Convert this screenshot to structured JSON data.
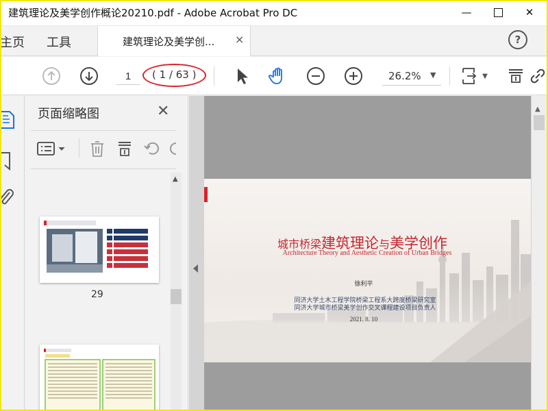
{
  "window": {
    "title": "建筑理论及美学创作概论20210.pdf - Adobe Acrobat Pro DC",
    "minimize": "—",
    "close": "✕"
  },
  "tabs": {
    "home": "主页",
    "tools": "工具",
    "doc_tab": "建筑理论及美学创...",
    "doc_tab_close": "×",
    "help": "?"
  },
  "toolbar": {
    "page_current": "1",
    "page_total": "( 1 / 63 )",
    "zoom": "26.2%",
    "icons": [
      "prev-page-icon",
      "next-page-icon",
      "select-arrow-icon",
      "hand-tool-icon",
      "zoom-out-icon",
      "zoom-in-icon",
      "fit-page-icon",
      "scroll-mode-icon",
      "link-icon"
    ]
  },
  "thumbnails_panel": {
    "heading": "页面缩略图",
    "close": "✕",
    "pages": [
      {
        "label": "29"
      },
      {
        "label": ""
      }
    ]
  },
  "slide": {
    "title_big_1": "建筑理论",
    "title_small_1": "城市桥梁",
    "title_small_2": "与",
    "title_big_2": "美学创作",
    "subtitle": "Architecture Theory and Aesthetic Creation of Urban Bridges",
    "author": "徐利平",
    "affiliation_1": "同济大学土木工程学院桥梁工程系大跨度桥梁研究室",
    "affiliation_2": "同济大学城市桥梁美学创作交叉课程建设项目负责人",
    "date": "2021. 8. 10"
  },
  "colors": {
    "accent_red": "#d9232a",
    "acrobat_blue": "#1473e6",
    "frame_yellow": "#f3e600"
  }
}
